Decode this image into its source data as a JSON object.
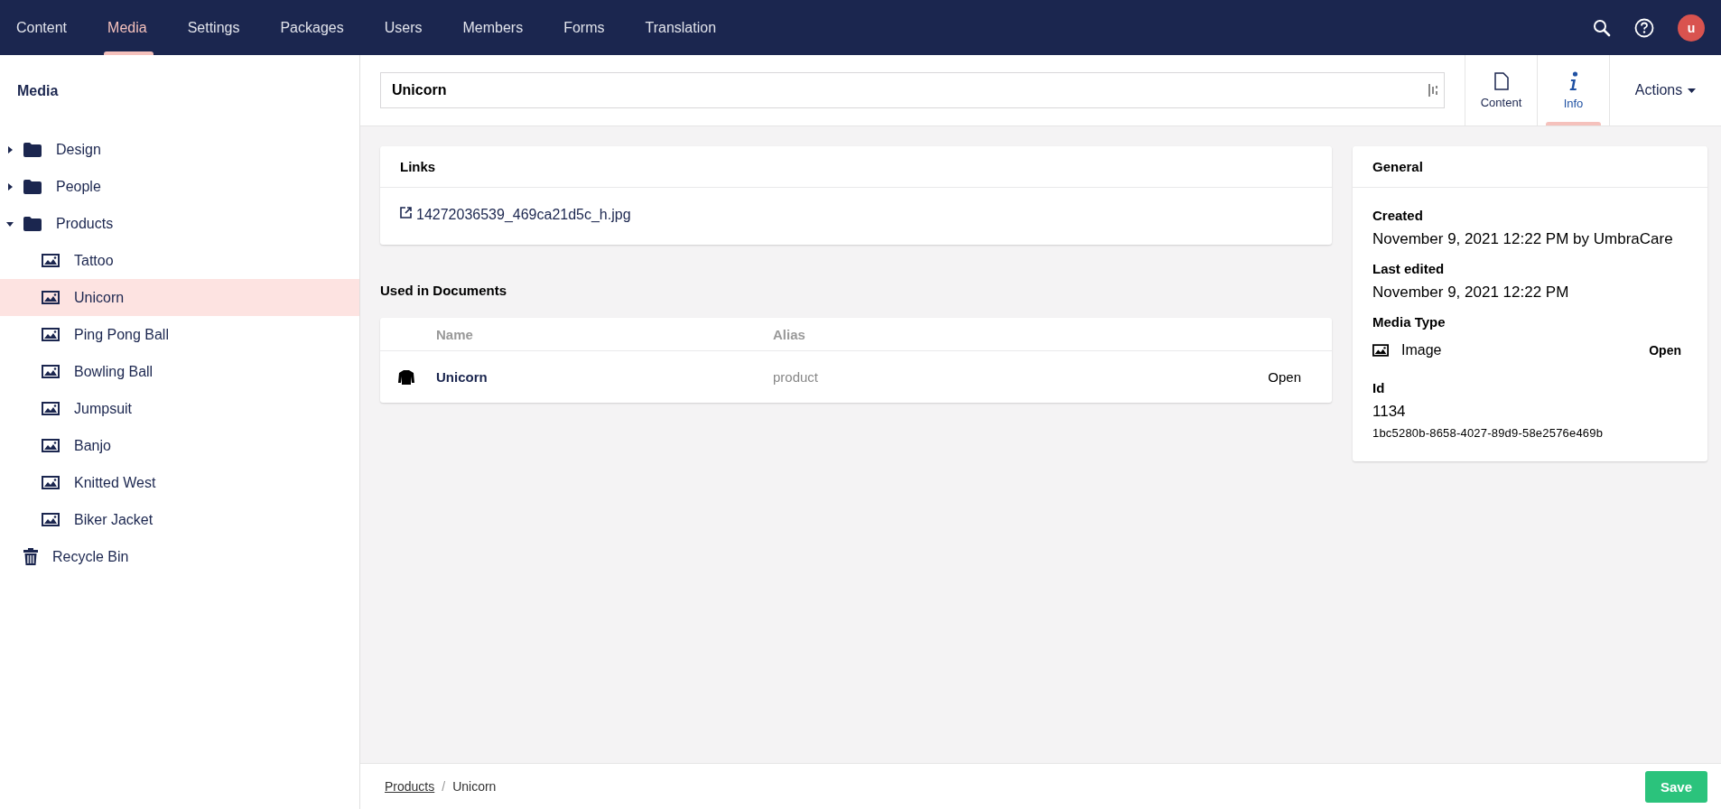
{
  "top_nav": {
    "sections": [
      {
        "label": "Content",
        "selected": false
      },
      {
        "label": "Media",
        "selected": true
      },
      {
        "label": "Settings",
        "selected": false
      },
      {
        "label": "Packages",
        "selected": false
      },
      {
        "label": "Users",
        "selected": false
      },
      {
        "label": "Members",
        "selected": false
      },
      {
        "label": "Forms",
        "selected": false
      },
      {
        "label": "Translation",
        "selected": false
      }
    ],
    "avatar": "u"
  },
  "sidebar": {
    "title": "Media",
    "tree": [
      {
        "label": "Design",
        "kind": "folder",
        "expanded": false,
        "selected": false
      },
      {
        "label": "People",
        "kind": "folder",
        "expanded": false,
        "selected": false
      },
      {
        "label": "Products",
        "kind": "folder",
        "expanded": true,
        "selected": false,
        "children": [
          {
            "label": "Tattoo",
            "kind": "image",
            "selected": false
          },
          {
            "label": "Unicorn",
            "kind": "image",
            "selected": true
          },
          {
            "label": "Ping Pong Ball",
            "kind": "image",
            "selected": false
          },
          {
            "label": "Bowling Ball",
            "kind": "image",
            "selected": false
          },
          {
            "label": "Jumpsuit",
            "kind": "image",
            "selected": false
          },
          {
            "label": "Banjo",
            "kind": "image",
            "selected": false
          },
          {
            "label": "Knitted West",
            "kind": "image",
            "selected": false
          },
          {
            "label": "Biker Jacket",
            "kind": "image",
            "selected": false
          }
        ]
      },
      {
        "label": "Recycle Bin",
        "kind": "recycle-bin",
        "selected": false
      }
    ]
  },
  "editor_header": {
    "name": "Unicorn",
    "apps": [
      {
        "label": "Content",
        "kind": "document",
        "selected": false
      },
      {
        "label": "Info",
        "kind": "info",
        "selected": true
      }
    ],
    "actions": "Actions"
  },
  "links": {
    "title": "Links",
    "items": [
      "14272036539_469ca21d5c_h.jpg"
    ]
  },
  "used_in_documents": {
    "title": "Used in Documents",
    "columns": [
      "Name",
      "Alias"
    ],
    "rows": [
      {
        "name": "Unicorn",
        "alias": "product",
        "action": "Open"
      }
    ]
  },
  "general": {
    "title": "General",
    "created_label": "Created",
    "created": "November 9, 2021 12:22 PM by UmbraCare",
    "edited_label": "Last edited",
    "edited": "November 9, 2021 12:22 PM",
    "type_label": "Media Type",
    "type": "Image",
    "type_action": "Open",
    "id_label": "Id",
    "id": "1134",
    "key": "1bc5280b-8658-4027-89d9-58e2576e469b"
  },
  "footer": {
    "breadcrumb": [
      "Products",
      "Unicorn"
    ],
    "separator": "/",
    "save": "Save"
  }
}
